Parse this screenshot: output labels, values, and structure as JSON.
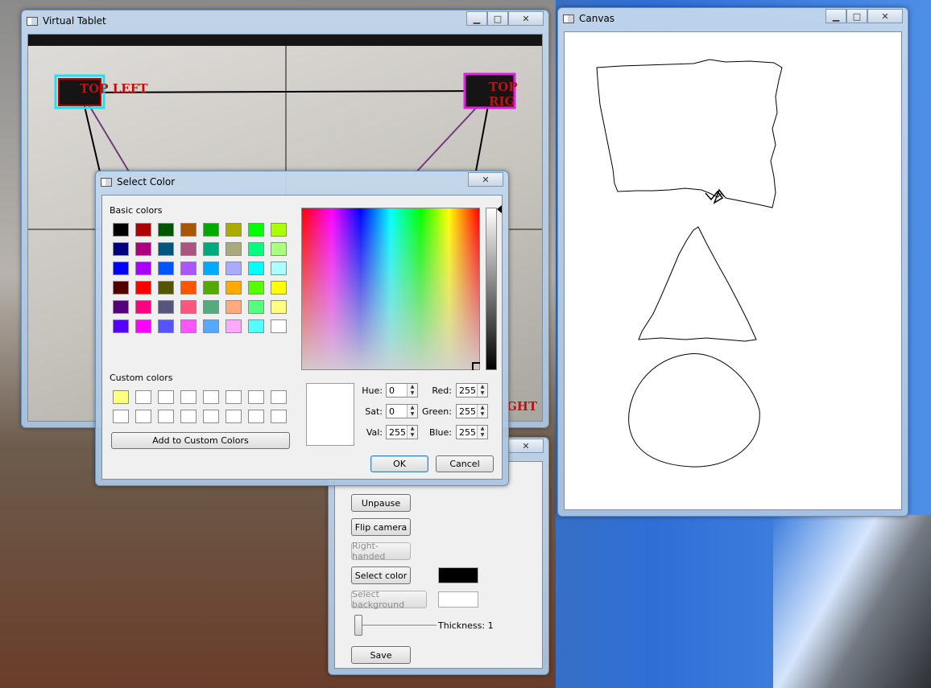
{
  "virtual_tablet": {
    "title": "Virtual Tablet",
    "marker_labels": {
      "top_left": "TOP LEFT",
      "top_right": "TOP RIG",
      "bottom_right": "GHT"
    }
  },
  "select_color": {
    "title": "Select Color",
    "basic_colors_label": "Basic colors",
    "basic_colors": [
      [
        "#000000",
        "#aa0000",
        "#005500",
        "#aa5500",
        "#00aa00",
        "#aaaa00",
        "#00ff00",
        "#aaff00"
      ],
      [
        "#00007f",
        "#aa007f",
        "#00557f",
        "#aa557f",
        "#00aa7f",
        "#aaaa7f",
        "#00ff7f",
        "#aaff7f"
      ],
      [
        "#0000ff",
        "#aa00ff",
        "#0055ff",
        "#aa55ff",
        "#00aaff",
        "#aaaaff",
        "#00ffff",
        "#aaffff"
      ],
      [
        "#550000",
        "#ff0000",
        "#555500",
        "#ff5500",
        "#55aa00",
        "#ffaa00",
        "#55ff00",
        "#ffff00"
      ],
      [
        "#55007f",
        "#ff007f",
        "#55557f",
        "#ff557f",
        "#55aa7f",
        "#ffaa7f",
        "#55ff7f",
        "#ffff7f"
      ],
      [
        "#5500ff",
        "#ff00ff",
        "#5555ff",
        "#ff55ff",
        "#55aaff",
        "#ffaaff",
        "#55ffff",
        "#ffffff"
      ]
    ],
    "custom_colors_label": "Custom colors",
    "custom_colors": [
      [
        "#ffff7f",
        "#ffffff",
        "#ffffff",
        "#ffffff",
        "#ffffff",
        "#ffffff",
        "#ffffff",
        "#ffffff"
      ],
      [
        "#ffffff",
        "#ffffff",
        "#ffffff",
        "#ffffff",
        "#ffffff",
        "#ffffff",
        "#ffffff",
        "#ffffff"
      ]
    ],
    "add_custom_label": "Add to Custom Colors",
    "fields": {
      "hue": {
        "label": "Hue:",
        "value": "0"
      },
      "sat": {
        "label": "Sat:",
        "value": "0"
      },
      "val": {
        "label": "Val:",
        "value": "255"
      },
      "red": {
        "label": "Red:",
        "value": "255"
      },
      "green": {
        "label": "Green:",
        "value": "255"
      },
      "blue": {
        "label": "Blue:",
        "value": "255"
      }
    },
    "ok_label": "OK",
    "cancel_label": "Cancel"
  },
  "controls": {
    "unpause_label": "Unpause",
    "flip_camera_label": "Flip camera",
    "right_handed_label": "Right-handed",
    "select_color_label": "Select color",
    "select_background_label": "Select background",
    "pen_color": "#000000",
    "background_color": "#ffffff",
    "thickness_label": "Thickness: 1",
    "thickness_value": 1,
    "save_label": "Save"
  },
  "canvas": {
    "title": "Canvas"
  },
  "window_buttons": {
    "minimize": "▁",
    "maximize": "□",
    "close": "✕"
  }
}
